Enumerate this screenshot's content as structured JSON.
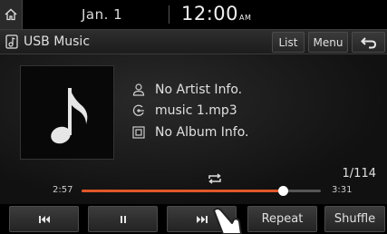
{
  "status": {
    "date": "Jan. 1",
    "time": "12:00",
    "ampm": "AM"
  },
  "header": {
    "title": "USB Music",
    "list_label": "List",
    "menu_label": "Menu"
  },
  "track": {
    "artist": "No Artist Info.",
    "file": "music 1.mp3",
    "album": "No Album Info.",
    "count": "1/114",
    "elapsed": "2:57",
    "total": "3:31",
    "progress_fraction": 0.84
  },
  "controls": {
    "repeat_label": "Repeat",
    "shuffle_label": "Shuffle"
  },
  "colors": {
    "progress": "#e0572a",
    "background": "#000000"
  },
  "icons": {
    "home": "home-icon",
    "usb_music": "music-file-icon",
    "back": "back-arrow-icon",
    "artist": "person-icon",
    "file": "file-icon",
    "album": "album-icon",
    "repeat": "repeat-icon",
    "prev": "previous-track-icon",
    "pause": "pause-icon",
    "next": "next-track-icon"
  }
}
